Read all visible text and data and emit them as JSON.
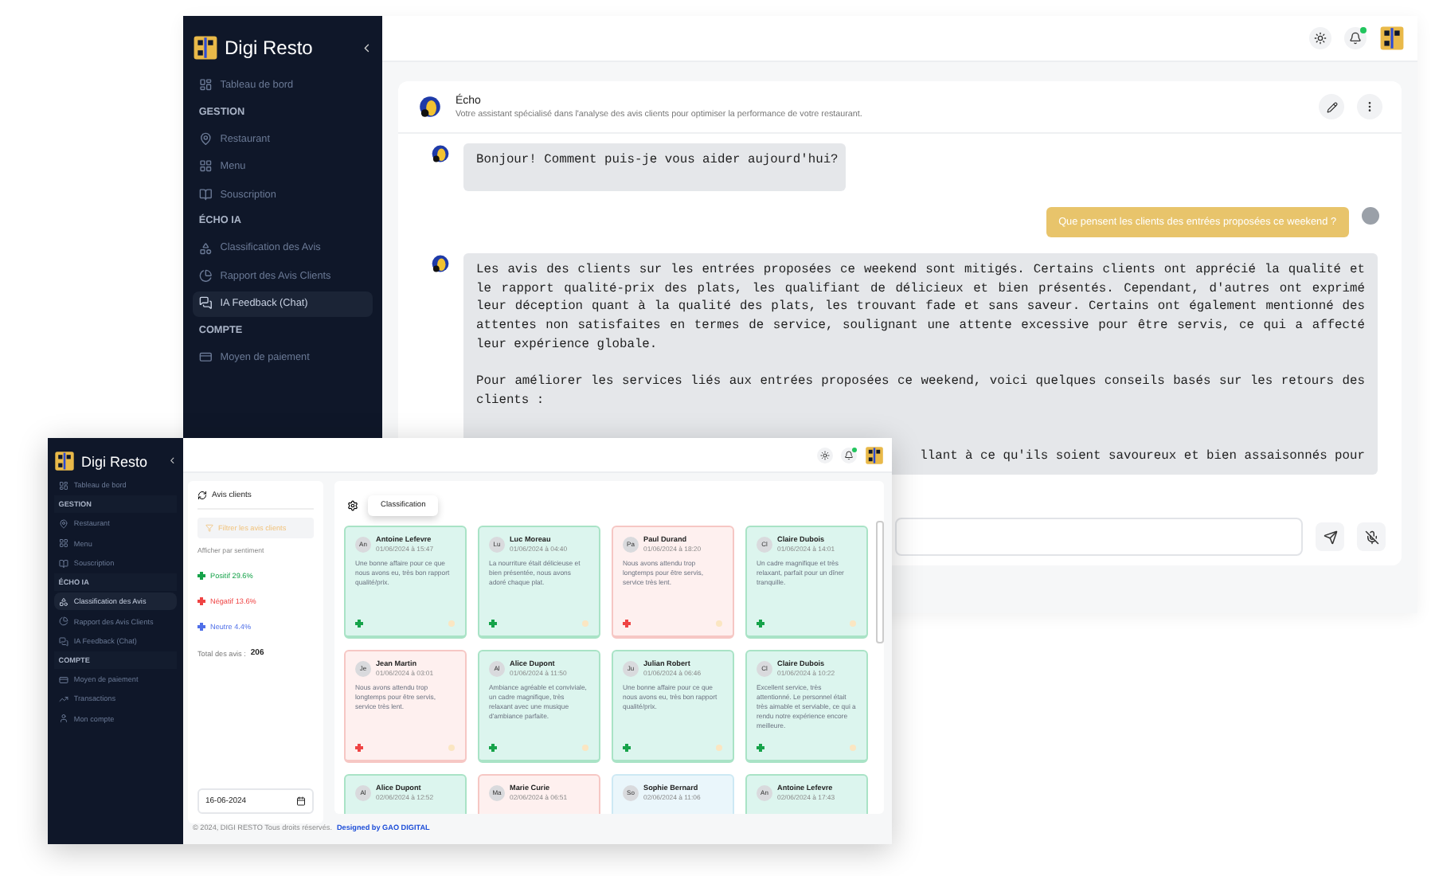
{
  "back_window": {
    "sidebar": {
      "brand": "Digi Resto",
      "items": [
        {
          "kind": "item",
          "label": "Tableau de bord",
          "selected": false
        },
        {
          "kind": "section",
          "label": "GESTION"
        },
        {
          "kind": "item",
          "label": "Restaurant",
          "selected": false
        },
        {
          "kind": "item",
          "label": "Menu",
          "selected": false
        },
        {
          "kind": "item",
          "label": "Souscription",
          "selected": false
        },
        {
          "kind": "section",
          "label": "ÉCHO IA"
        },
        {
          "kind": "item",
          "label": "Classification des Avis",
          "selected": false
        },
        {
          "kind": "item",
          "label": "Rapport des Avis Clients",
          "selected": false
        },
        {
          "kind": "item",
          "label": "IA Feedback (Chat)",
          "selected": true
        },
        {
          "kind": "section",
          "label": "COMPTE"
        },
        {
          "kind": "item",
          "label": "Moyen de paiement",
          "selected": false
        }
      ]
    },
    "chat": {
      "assistant_name": "Écho",
      "assistant_subtitle": "Votre assistant spécialisé dans l'analyse des avis clients pour optimiser la performance de votre restaurant.",
      "messages": [
        {
          "kind": "bot",
          "paragraphs": [
            "Bonjour! Comment puis-je vous aider aujourd'hui?"
          ]
        },
        {
          "kind": "user",
          "paragraphs": [
            "Que pensent les clients des entrées proposées ce weekend ?"
          ]
        },
        {
          "kind": "bot",
          "paragraphs": [
            "Les avis des clients sur les entrées proposées ce weekend sont mitigés. Certains clients ont apprécié la qualité et le rapport qualité-prix des plats, les qualifiant de délicieux et bien présentés. Cependant, d'autres ont exprimé leur déception quant à la qualité des plats, les trouvant fade et sans saveur. Certains ont également mentionné des attentes non satisfaites en termes de service, soulignant une attente excessive pour être servis, ce qui a affecté leur expérience globale.",
            "Pour améliorer les services liés aux entrées proposées ce weekend, voici quelques conseils basés sur les retours des clients :"
          ],
          "partial_line": "llant à ce qu'ils soient savoureux et bien assaisonnés pour"
        }
      ]
    }
  },
  "front_window": {
    "sidebar": {
      "brand": "Digi Resto",
      "items": [
        {
          "kind": "item",
          "label": "Tableau de bord",
          "selected": false
        },
        {
          "kind": "section",
          "label": "GESTION"
        },
        {
          "kind": "item",
          "label": "Restaurant",
          "selected": false
        },
        {
          "kind": "item",
          "label": "Menu",
          "selected": false
        },
        {
          "kind": "item",
          "label": "Souscription",
          "selected": false
        },
        {
          "kind": "section",
          "label": "ÉCHO IA"
        },
        {
          "kind": "item",
          "label": "Classification des Avis",
          "selected": true
        },
        {
          "kind": "item",
          "label": "Rapport des Avis Clients",
          "selected": false
        },
        {
          "kind": "item",
          "label": "IA Feedback (Chat)",
          "selected": false
        },
        {
          "kind": "section",
          "label": "COMPTE"
        },
        {
          "kind": "item",
          "label": "Moyen de paiement",
          "selected": false
        },
        {
          "kind": "item",
          "label": "Transactions",
          "selected": false
        },
        {
          "kind": "item",
          "label": "Mon compte",
          "selected": false
        }
      ]
    },
    "filter_panel": {
      "title": "Avis clients",
      "filter_button": "Filtrer les avis clients",
      "sentiment_heading": "Afficher par sentiment",
      "sentiments": [
        {
          "label": "Positif 29.6%",
          "color": "#16a34a"
        },
        {
          "label": "Négatif 13.6%",
          "color": "#ef4444"
        },
        {
          "label": "Neutre 4.4%",
          "color": "#4f6fe8"
        }
      ],
      "total_label": "Total des avis :",
      "total_value": "206",
      "date": "16-06-2024"
    },
    "classification_tab": "Classification",
    "reviews": [
      {
        "initials": "An",
        "name": "Antoine Lefevre",
        "date": "01/06/2024 à 15:47",
        "text": "Une bonne affaire pour ce que nous avons eu, très bon rapport qualité/prix.",
        "kind": "positive",
        "color": "#16a34a"
      },
      {
        "initials": "Lu",
        "name": "Luc Moreau",
        "date": "01/06/2024 à 04:40",
        "text": "La nourriture était délicieuse et bien présentée, nous avons adoré chaque plat.",
        "kind": "positive",
        "color": "#16a34a"
      },
      {
        "initials": "Pa",
        "name": "Paul Durand",
        "date": "01/06/2024 à 18:20",
        "text": "Nous avons attendu trop longtemps pour être servis, service très lent.",
        "kind": "negative",
        "color": "#ef4444"
      },
      {
        "initials": "Cl",
        "name": "Claire Dubois",
        "date": "01/06/2024 à 14:01",
        "text": "Un cadre magnifique et très relaxant, parfait pour un dîner tranquille.",
        "kind": "positive",
        "color": "#16a34a"
      },
      {
        "initials": "Je",
        "name": "Jean Martin",
        "date": "01/06/2024 à 03:01",
        "text": "Nous avons attendu trop longtemps pour être servis, service très lent.",
        "kind": "negative",
        "color": "#ef4444"
      },
      {
        "initials": "Al",
        "name": "Alice Dupont",
        "date": "01/06/2024 à 11:50",
        "text": "Ambiance agréable et conviviale, un cadre magnifique, très relaxant avec une musique d'ambiance parfaite.",
        "kind": "positive",
        "color": "#16a34a"
      },
      {
        "initials": "Ju",
        "name": "Julian Robert",
        "date": "01/06/2024 à 06:46",
        "text": "Une bonne affaire pour ce que nous avons eu, très bon rapport qualité/prix.",
        "kind": "positive",
        "color": "#16a34a"
      },
      {
        "initials": "Cl",
        "name": "Claire Dubois",
        "date": "01/06/2024 à 10:22",
        "text": "Excellent service, très attentionné. Le personnel était très aimable et serviable, ce qui a rendu notre expérience encore meilleure.",
        "kind": "positive",
        "color": "#16a34a"
      },
      {
        "initials": "Al",
        "name": "Alice Dupont",
        "date": "02/06/2024 à 12:52",
        "kind": "positive"
      },
      {
        "initials": "Ma",
        "name": "Marie Curie",
        "date": "02/06/2024 à 06:51",
        "kind": "negative"
      },
      {
        "initials": "So",
        "name": "Sophie Bernard",
        "date": "02/06/2024 à 11:06",
        "kind": "neutral"
      },
      {
        "initials": "An",
        "name": "Antoine Lefevre",
        "date": "02/06/2024 à 17:43",
        "kind": "positive"
      }
    ],
    "footer": {
      "copyright": "© 2024, DIGI RESTO Tous droits réservés.",
      "designer_link": "Designed by GAO DIGITAL"
    }
  }
}
